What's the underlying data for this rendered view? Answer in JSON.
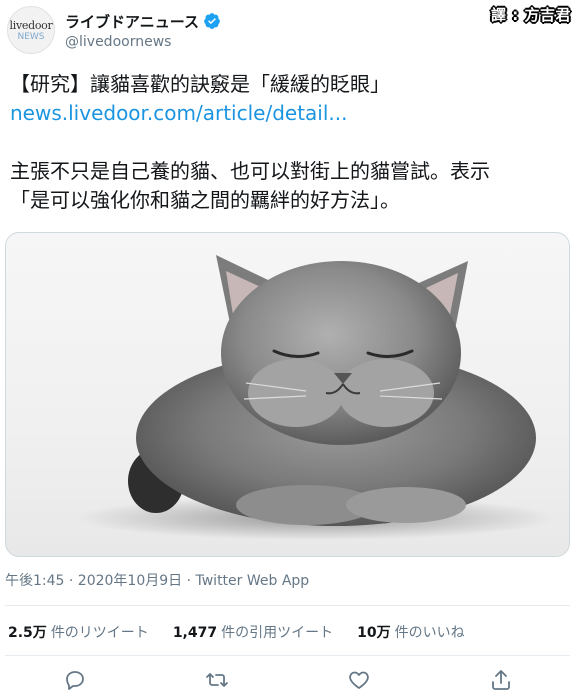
{
  "account": {
    "avatar_line1": "livedoor",
    "avatar_line2": "NEWS",
    "display_name": "ライブドアニュース",
    "handle": "@livedoornews",
    "verified_icon": "verified-badge-icon"
  },
  "watermark": "譯 : 方吉君",
  "tweet": {
    "headline": "【研究】讓貓喜歡的訣竅是「緩緩的眨眼」",
    "link": "news.livedoor.com/article/detail...",
    "text_line1": "主張不只是自己養的貓、也可以對街上的貓嘗試。表示",
    "text_line2": "「是可以強化你和貓之間的羈絆的好方法」。"
  },
  "media": {
    "description_icon": "cat-photo"
  },
  "meta": {
    "timestamp": "午後1:45 · 2020年10月9日 · Twitter Web App"
  },
  "stats": {
    "retweets_count": "2.5万",
    "retweets_label": "件のリツイート",
    "quotes_count": "1,477",
    "quotes_label": "件の引用ツイート",
    "likes_count": "10万",
    "likes_label": "件のいいね"
  },
  "actions": {
    "reply_icon": "reply-icon",
    "retweet_icon": "retweet-icon",
    "like_icon": "heart-icon",
    "share_icon": "share-icon"
  },
  "colors": {
    "link": "#1b95e0",
    "secondary_text": "#657786",
    "verified": "#1da1f2",
    "divider": "#e6ecf0"
  }
}
